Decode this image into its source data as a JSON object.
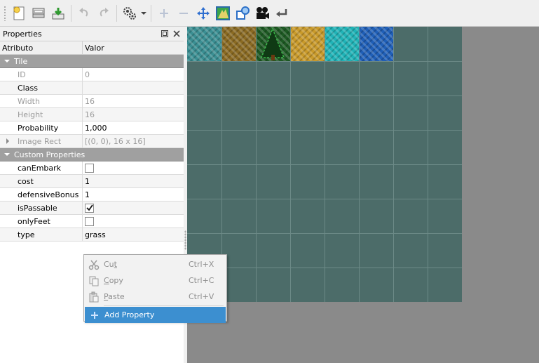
{
  "toolbar": {
    "buttons": [
      {
        "icon": "new-tileset-icon"
      },
      {
        "icon": "open-icon"
      },
      {
        "icon": "save-icon"
      },
      {
        "icon": "undo-icon"
      },
      {
        "icon": "redo-icon"
      },
      {
        "icon": "tools-gear-icon"
      },
      {
        "icon": "add-tiles-icon"
      },
      {
        "icon": "remove-tiles-icon"
      },
      {
        "icon": "move-icon"
      },
      {
        "icon": "terrain-icon"
      },
      {
        "icon": "collision-editor-icon"
      },
      {
        "icon": "animation-editor-icon"
      },
      {
        "icon": "dynamic-wrapping-icon"
      }
    ]
  },
  "properties_panel": {
    "title": "Properties",
    "header": {
      "attribute": "Atributo",
      "value": "Valor"
    },
    "groups": [
      {
        "name": "Tile",
        "rows": [
          {
            "name": "ID",
            "value": "0",
            "readonly": true
          },
          {
            "name": "Class",
            "value": "",
            "readonly": false
          },
          {
            "name": "Width",
            "value": "16",
            "readonly": true
          },
          {
            "name": "Height",
            "value": "16",
            "readonly": true
          },
          {
            "name": "Probability",
            "value": "1,000",
            "readonly": false
          },
          {
            "name": "Image Rect",
            "value": "[(0, 0), 16 x 16]",
            "readonly": true
          }
        ]
      },
      {
        "name": "Custom Properties",
        "rows": [
          {
            "name": "canEmbark",
            "type": "bool",
            "checked": false
          },
          {
            "name": "cost",
            "value": "1"
          },
          {
            "name": "defensiveBonus",
            "value": "1"
          },
          {
            "name": "isPassable",
            "type": "bool",
            "checked": true
          },
          {
            "name": "onlyFeet",
            "type": "bool",
            "checked": false
          },
          {
            "name": "type",
            "value": "grass"
          }
        ]
      }
    ]
  },
  "context_menu": {
    "items": [
      {
        "label_pre": "Cu",
        "label_ul": "t",
        "label_post": "",
        "shortcut": "Ctrl+X",
        "icon": "scissors-icon",
        "enabled": false
      },
      {
        "label_pre": "",
        "label_ul": "C",
        "label_post": "opy",
        "shortcut": "Ctrl+C",
        "icon": "copy-icon",
        "enabled": false
      },
      {
        "label_pre": "",
        "label_ul": "P",
        "label_post": "aste",
        "shortcut": "Ctrl+V",
        "icon": "paste-icon",
        "enabled": false
      },
      {
        "label": "Add Property",
        "shortcut": "",
        "icon": "add-icon",
        "enabled": true,
        "highlighted": true
      }
    ]
  },
  "tileset": {
    "columns": 8,
    "rows": 8,
    "tiles": [
      {
        "name": "shallow-water",
        "color": "#3a8f93"
      },
      {
        "name": "dirt",
        "color": "#8a6a22"
      },
      {
        "name": "forest",
        "color": "#1d5a23"
      },
      {
        "name": "sand",
        "color": "#c99a2a"
      },
      {
        "name": "cyan-water",
        "color": "#1fb3b7"
      },
      {
        "name": "deep-water",
        "color": "#1f5fb8"
      }
    ],
    "grid_background": "#4c6c69"
  }
}
